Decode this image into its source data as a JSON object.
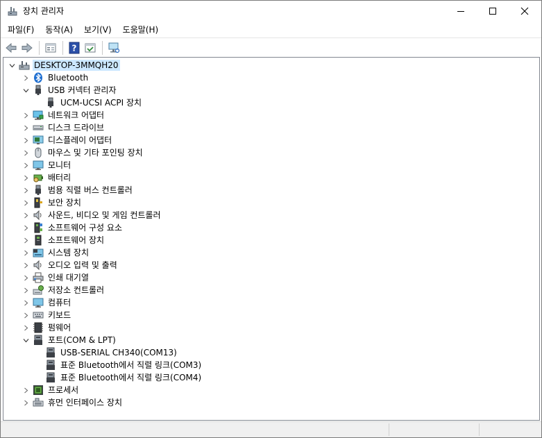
{
  "window": {
    "title": "장치 관리자"
  },
  "menu": [
    {
      "key": "file",
      "label": "파일(F)"
    },
    {
      "key": "action",
      "label": "동작(A)"
    },
    {
      "key": "view",
      "label": "보기(V)"
    },
    {
      "key": "help",
      "label": "도움말(H)"
    }
  ],
  "toolbar": [
    "back-icon",
    "forward-icon",
    "properties-icon",
    "help-icon",
    "update-driver-icon",
    "scan-hardware-icon"
  ],
  "tree": [
    {
      "level": 0,
      "state": "expanded",
      "icon": "computer-icon",
      "label": "DESKTOP-3MMQH20",
      "selected": true
    },
    {
      "level": 1,
      "state": "collapsed",
      "icon": "bluetooth-icon",
      "label": "Bluetooth"
    },
    {
      "level": 1,
      "state": "expanded",
      "icon": "usb-icon",
      "label": "USB 커넥터 관리자"
    },
    {
      "level": 2,
      "state": "none",
      "icon": "usb-icon",
      "label": "UCM-UCSI ACPI 장치"
    },
    {
      "level": 1,
      "state": "collapsed",
      "icon": "network-adapter-icon",
      "label": "네트워크 어댑터"
    },
    {
      "level": 1,
      "state": "collapsed",
      "icon": "disk-drive-icon",
      "label": "디스크 드라이브"
    },
    {
      "level": 1,
      "state": "collapsed",
      "icon": "display-adapter-icon",
      "label": "디스플레이 어댑터"
    },
    {
      "level": 1,
      "state": "collapsed",
      "icon": "mouse-icon",
      "label": "마우스 및 기타 포인팅 장치"
    },
    {
      "level": 1,
      "state": "collapsed",
      "icon": "monitor-icon",
      "label": "모니터"
    },
    {
      "level": 1,
      "state": "collapsed",
      "icon": "battery-icon",
      "label": "배터리"
    },
    {
      "level": 1,
      "state": "collapsed",
      "icon": "usb-icon",
      "label": "범용 직렬 버스 컨트롤러"
    },
    {
      "level": 1,
      "state": "collapsed",
      "icon": "security-device-icon",
      "label": "보안 장치"
    },
    {
      "level": 1,
      "state": "collapsed",
      "icon": "speaker-icon",
      "label": "사운드, 비디오 및 게임 컨트롤러"
    },
    {
      "level": 1,
      "state": "collapsed",
      "icon": "software-component-icon",
      "label": "소프트웨어 구성 요소"
    },
    {
      "level": 1,
      "state": "collapsed",
      "icon": "software-device-icon",
      "label": "소프트웨어 장치"
    },
    {
      "level": 1,
      "state": "collapsed",
      "icon": "system-device-icon",
      "label": "시스템 장치"
    },
    {
      "level": 1,
      "state": "collapsed",
      "icon": "speaker-icon",
      "label": "오디오 입력 및 출력"
    },
    {
      "level": 1,
      "state": "collapsed",
      "icon": "printer-icon",
      "label": "인쇄 대기열"
    },
    {
      "level": 1,
      "state": "collapsed",
      "icon": "storage-controller-icon",
      "label": "저장소 컨트롤러"
    },
    {
      "level": 1,
      "state": "collapsed",
      "icon": "monitor-icon",
      "label": "컴퓨터"
    },
    {
      "level": 1,
      "state": "collapsed",
      "icon": "keyboard-icon",
      "label": "키보드"
    },
    {
      "level": 1,
      "state": "collapsed",
      "icon": "firmware-icon",
      "label": "펌웨어"
    },
    {
      "level": 1,
      "state": "expanded",
      "icon": "port-icon",
      "label": "포트(COM & LPT)"
    },
    {
      "level": 2,
      "state": "none",
      "icon": "port-icon",
      "label": "USB-SERIAL CH340(COM13)"
    },
    {
      "level": 2,
      "state": "none",
      "icon": "port-icon",
      "label": "표준 Bluetooth에서 직렬 링크(COM3)"
    },
    {
      "level": 2,
      "state": "none",
      "icon": "port-icon",
      "label": "표준 Bluetooth에서 직렬 링크(COM4)"
    },
    {
      "level": 1,
      "state": "collapsed",
      "icon": "processor-icon",
      "label": "프로세서"
    },
    {
      "level": 1,
      "state": "collapsed",
      "icon": "hid-icon",
      "label": "휴먼 인터페이스 장치"
    }
  ]
}
